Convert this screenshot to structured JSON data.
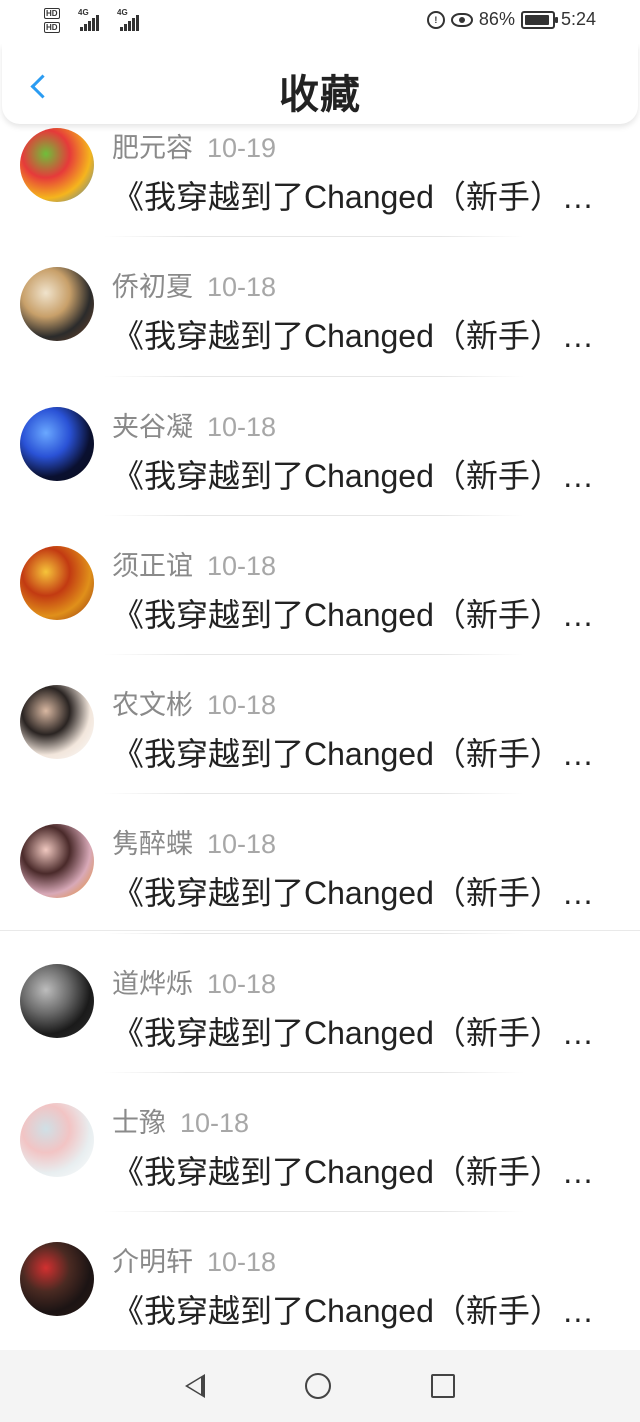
{
  "status_bar": {
    "hd_labels": [
      "HD",
      "HD"
    ],
    "network": [
      "4G",
      "4G"
    ],
    "battery_percent": "86%",
    "time": "5:24"
  },
  "header": {
    "title": "收藏"
  },
  "items": [
    {
      "name": "肥元容",
      "date": "10-19",
      "title": "《我穿越到了Changed（新手）…",
      "avatar_colors": [
        "#f5b51d",
        "#e63a3a",
        "#6fbf3a",
        "#2f77c9"
      ]
    },
    {
      "name": "侨初夏",
      "date": "10-18",
      "title": "《我穿越到了Changed（新手）…",
      "avatar_colors": [
        "#2b2b2b",
        "#c8a06a",
        "#f0e3cc",
        "#7a4a2a"
      ]
    },
    {
      "name": "夹谷凝",
      "date": "10-18",
      "title": "《我穿越到了Changed（新手）…",
      "avatar_colors": [
        "#0a1030",
        "#2a52d6",
        "#6aa8ff",
        "#0c0c1a"
      ]
    },
    {
      "name": "须正谊",
      "date": "10-18",
      "title": "《我穿越到了Changed（新手）…",
      "avatar_colors": [
        "#e0901a",
        "#c23a12",
        "#f6c43a",
        "#8b2a10"
      ]
    },
    {
      "name": "农文彬",
      "date": "10-18",
      "title": "《我穿越到了Changed（新手）…",
      "avatar_colors": [
        "#f2e6dc",
        "#2a2422",
        "#d9b8a2",
        "#ffffff"
      ]
    },
    {
      "name": "隽醉蝶",
      "date": "10-18",
      "title": "《我穿越到了Changed（新手）…",
      "avatar_colors": [
        "#d8a9b8",
        "#4a2a2a",
        "#f0c8c0",
        "#e88a1a"
      ]
    },
    {
      "name": "道烨烁",
      "date": "10-18",
      "title": "《我穿越到了Changed（新手）…",
      "avatar_colors": [
        "#1a1a1a",
        "#6a6a6a",
        "#bdbdbd",
        "#303030"
      ]
    },
    {
      "name": "士豫",
      "date": "10-18",
      "title": "《我穿越到了Changed（新手）…",
      "avatar_colors": [
        "#e8eef0",
        "#f2c4c4",
        "#cfe0e6",
        "#ffffff"
      ]
    },
    {
      "name": "介明轩",
      "date": "10-18",
      "title": "《我穿越到了Changed（新手）…",
      "avatar_colors": [
        "#1c1414",
        "#4a2a22",
        "#d23030",
        "#2a1a16"
      ]
    }
  ],
  "nav_bar": {
    "icons": [
      "back-triangle-icon",
      "home-circle-icon",
      "recents-square-icon"
    ]
  },
  "colors": {
    "accent": "#2b9cf2",
    "name_gray": "#8a8a8a",
    "date_gray": "#a7a7a7"
  }
}
